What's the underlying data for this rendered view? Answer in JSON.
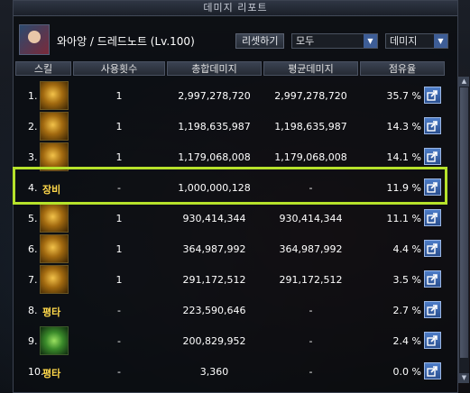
{
  "window": {
    "title": "데미지 리포트"
  },
  "character": {
    "name": "와아앙 / 드레드노트 (Lv.100)"
  },
  "controls": {
    "reset_label": "리셋하기",
    "filter_value": "모두",
    "sort_value": "데미지"
  },
  "columns": {
    "skill": "스킬",
    "uses": "사용횟수",
    "total": "총합데미지",
    "average": "평균데미지",
    "share": "점유율"
  },
  "rows": [
    {
      "rank": "1.",
      "skill_text": "",
      "icon": "skill-icon-golden-slash",
      "uses": "1",
      "total": "2,997,278,720",
      "average": "2,997,278,720",
      "share": "35.7 %"
    },
    {
      "rank": "2.",
      "skill_text": "",
      "icon": "skill-icon-golden-slash",
      "uses": "1",
      "total": "1,198,635,987",
      "average": "1,198,635,987",
      "share": "14.3 %"
    },
    {
      "rank": "3.",
      "skill_text": "",
      "icon": "skill-icon-golden-slash",
      "uses": "1",
      "total": "1,179,068,008",
      "average": "1,179,068,008",
      "share": "14.1 %"
    },
    {
      "rank": "4.",
      "skill_text": "장비",
      "icon": "",
      "uses": "-",
      "total": "1,000,000,128",
      "average": "-",
      "share": "11.9 %"
    },
    {
      "rank": "5.",
      "skill_text": "",
      "icon": "skill-icon-golden-slash",
      "uses": "1",
      "total": "930,414,344",
      "average": "930,414,344",
      "share": "11.1 %"
    },
    {
      "rank": "6.",
      "skill_text": "",
      "icon": "skill-icon-golden-slash",
      "uses": "1",
      "total": "364,987,992",
      "average": "364,987,992",
      "share": "4.4 %"
    },
    {
      "rank": "7.",
      "skill_text": "",
      "icon": "skill-icon-golden-slash",
      "uses": "1",
      "total": "291,172,512",
      "average": "291,172,512",
      "share": "3.5 %"
    },
    {
      "rank": "8.",
      "skill_text": "평타",
      "icon": "",
      "uses": "-",
      "total": "223,590,646",
      "average": "-",
      "share": "2.7 %"
    },
    {
      "rank": "9.",
      "skill_text": "",
      "icon": "skill-icon-green-crest",
      "uses": "-",
      "total": "200,829,952",
      "average": "-",
      "share": "2.4 %"
    },
    {
      "rank": "10.",
      "skill_text": "평타",
      "icon": "",
      "uses": "-",
      "total": "3,360",
      "average": "-",
      "share": "0.0 %"
    }
  ],
  "icons": {
    "share_button": "share-export-icon",
    "dropdown": "chevron-down-icon"
  },
  "colors": {
    "highlight": "#b6e22b",
    "skill_text": "#ffd84a",
    "share_button": "#3a66b0"
  }
}
